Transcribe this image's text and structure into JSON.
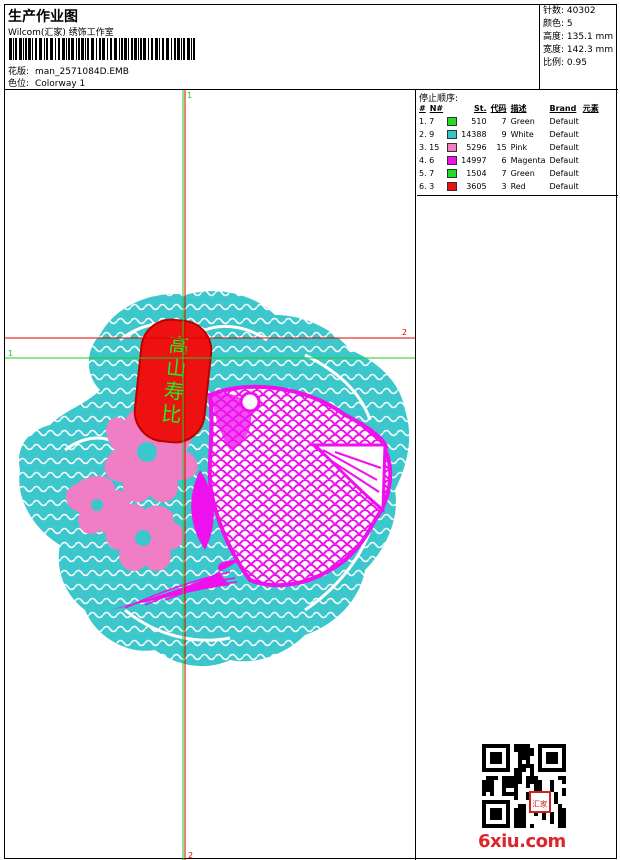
{
  "header": {
    "title": "生产作业图",
    "company": "Wilcom(汇家) 绣饰工作室",
    "design_label": "花版:",
    "design_value": "man_2571084D.EMB",
    "colorway_label": "色位:",
    "colorway_value": "Colorway 1"
  },
  "specs": [
    {
      "label": "针数:",
      "value": "40302"
    },
    {
      "label": "颜色:",
      "value": "5"
    },
    {
      "label": "高度:",
      "value": "135.1 mm"
    },
    {
      "label": "宽度:",
      "value": "142.3 mm"
    },
    {
      "label": "比例:",
      "value": "0.95"
    }
  ],
  "stop_sequence": {
    "title": "停止顺序:",
    "columns": [
      "#",
      "N#",
      "St.",
      "代码",
      "描述",
      "Brand",
      "元素"
    ],
    "rows": [
      {
        "idx": "1. 7",
        "color": "#22dd22",
        "stitches": "510",
        "code": "7",
        "desc": "Green",
        "brand": "Default"
      },
      {
        "idx": "2. 9",
        "color": "#33c6c8",
        "stitches": "14388",
        "code": "9",
        "desc": "White",
        "brand": "Default"
      },
      {
        "idx": "3. 15",
        "color": "#f080c0",
        "stitches": "5296",
        "code": "15",
        "desc": "Pink",
        "brand": "Default"
      },
      {
        "idx": "4. 6",
        "color": "#ee11ee",
        "stitches": "14997",
        "code": "6",
        "desc": "Magenta",
        "brand": "Default"
      },
      {
        "idx": "5. 7",
        "color": "#22dd22",
        "stitches": "1504",
        "code": "7",
        "desc": "Green",
        "brand": "Default"
      },
      {
        "idx": "6. 3",
        "color": "#ee1111",
        "stitches": "3605",
        "code": "3",
        "desc": "Red",
        "brand": "Default"
      }
    ]
  },
  "guides": {
    "v1": "1",
    "v2": "2",
    "h1": "1",
    "h2": "2"
  },
  "colors": {
    "teal": "#3cc7cc",
    "pink": "#f07ec4",
    "magenta": "#ee11ee",
    "red": "#ee1111",
    "green": "#22ee22",
    "guide_red": "#dd0000",
    "guide_green": "#22cc22"
  },
  "seal_text": "高山寿比",
  "qr_stamp_text": "汇家",
  "brand_watermark": "6xiu.com"
}
